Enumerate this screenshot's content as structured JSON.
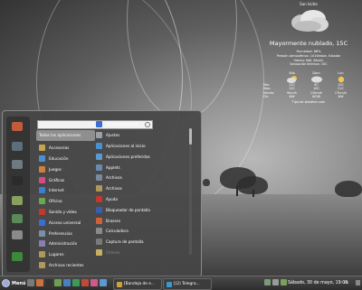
{
  "weather": {
    "location": "San Isidro",
    "condition": "Mayormente nublado, 15C",
    "details": [
      "Humedad: 88%",
      "Presión atmosférica: 1016mbar, Estable",
      "Viento: NW, 8km/h",
      "Sensación térmica: 15C"
    ],
    "forecast_days": [
      "Sáb",
      "Dom",
      "Lun"
    ],
    "forecast_rows": [
      {
        "label": "Min:",
        "values": [
          "11C",
          "9C",
          "10C"
        ]
      },
      {
        "label": "Max:",
        "values": [
          "15C",
          "16C",
          "21C"
        ]
      },
      {
        "label": "Viento:",
        "values": [
          "9km/h",
          "13km/h",
          "17km/h"
        ]
      },
      {
        "label": "Dir:",
        "values": [
          "NW",
          "WSW",
          "NW"
        ]
      }
    ],
    "provider": "Tipo de weather.com"
  },
  "menu": {
    "search_placeholder": "",
    "categories": [
      {
        "label": "Todas las aplicaciones",
        "color": "#8f8f8f",
        "selected": true
      },
      {
        "label": "Accesorios",
        "color": "#c9a24c"
      },
      {
        "label": "Educación",
        "color": "#4a8fd0"
      },
      {
        "label": "Juegos",
        "color": "#d0803a"
      },
      {
        "label": "Gráficos",
        "color": "#d64a8a"
      },
      {
        "label": "Internet",
        "color": "#3a7fd0"
      },
      {
        "label": "Oficina",
        "color": "#6aa84f"
      },
      {
        "label": "Sonido y vídeo",
        "color": "#c0392b"
      },
      {
        "label": "Acceso universal",
        "color": "#3a6fd0"
      },
      {
        "label": "Preferencias",
        "color": "#7a8fa8"
      },
      {
        "label": "Administración",
        "color": "#8a7fb0"
      },
      {
        "label": "Lugares",
        "color": "#b0985a"
      },
      {
        "label": "Archivos recientes",
        "color": "#b0985a"
      }
    ],
    "apps": [
      {
        "label": "Acceso universal",
        "color": "#3a6fd0"
      },
      {
        "label": "Ajustes",
        "color": "#9aa0a8"
      },
      {
        "label": "Aplicaciones al inicio",
        "color": "#4a8fd0"
      },
      {
        "label": "Aplicaciones preferidas",
        "color": "#5a9ad0"
      },
      {
        "label": "Applets",
        "color": "#6a8ab0"
      },
      {
        "label": "Archivos",
        "color": "#7a8a9a"
      },
      {
        "label": "Archivos",
        "color": "#b0985a"
      },
      {
        "label": "Ayuda",
        "color": "#c0392b"
      },
      {
        "label": "Bloqueador de pantalla",
        "color": "#3a5fa8"
      },
      {
        "label": "Brasero",
        "color": "#d0603a"
      },
      {
        "label": "Calculadora",
        "color": "#8a8a8a"
      },
      {
        "label": "Captura de pantalla",
        "color": "#7a7a7a"
      },
      {
        "label": "Cheese",
        "color": "#c9b060",
        "dim": true
      }
    ],
    "favorites": [
      {
        "name": "firefox-icon",
        "color": "#c25b3a"
      },
      {
        "name": "software-manager-icon",
        "color": "#5b6f7a"
      },
      {
        "name": "settings-icon",
        "color": "#6f7a80"
      },
      {
        "name": "terminal-icon",
        "color": "#2b2b2b"
      },
      {
        "name": "files-icon",
        "color": "#8aa060"
      },
      {
        "name": "lock-screen-icon",
        "color": "#5a8a5a"
      },
      {
        "name": "logout-icon",
        "color": "#8a8a8a"
      },
      {
        "name": "shutdown-icon",
        "color": "#3a8a3a"
      }
    ]
  },
  "panel": {
    "menu_label": "Menú",
    "launchers": [
      {
        "name": "show-desktop-icon",
        "color": "#7a7a7a"
      },
      {
        "name": "firefox-launcher-icon",
        "color": "#d0703a"
      },
      {
        "name": "terminal-launcher-icon",
        "color": "#333333"
      },
      {
        "name": "files-launcher-icon",
        "color": "#6aa04f"
      },
      {
        "name": "mail-launcher-icon",
        "color": "#4a7fc0"
      },
      {
        "name": "office-launcher-icon",
        "color": "#3a9a5a"
      },
      {
        "name": "media-launcher-icon",
        "color": "#c04a3a"
      },
      {
        "name": "image-launcher-icon",
        "color": "#d05a8a"
      },
      {
        "name": "chat-launcher-icon",
        "color": "#5a9ad0"
      }
    ],
    "tasks": [
      {
        "label": "[Bandeja de e...",
        "color": "#d0a03a"
      },
      {
        "label": "[(2) Telegra...",
        "color": "#3a9ad0"
      }
    ],
    "clock": "Sábado, 30 de mayo, 19:05",
    "lang": "es"
  }
}
